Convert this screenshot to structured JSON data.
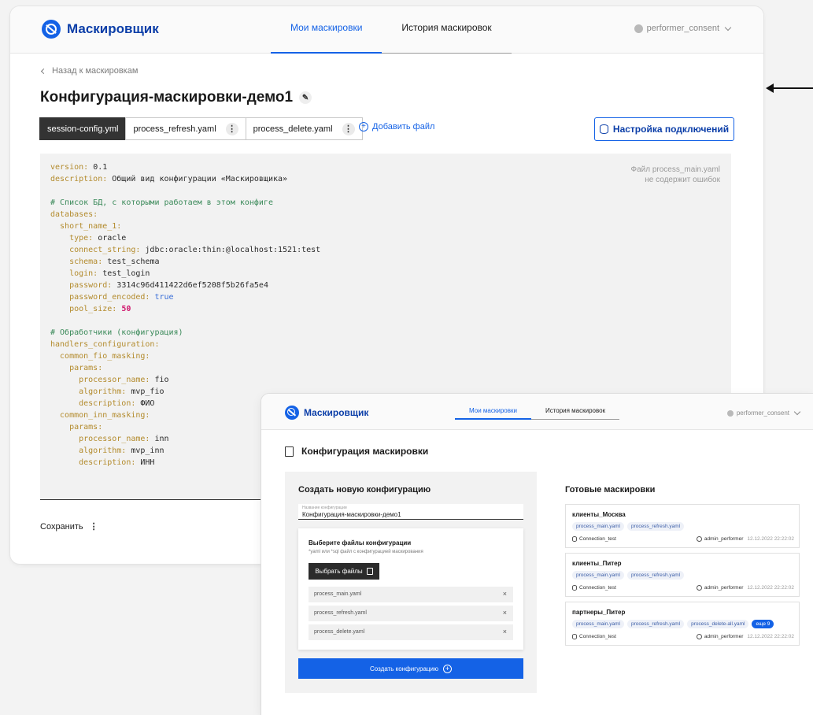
{
  "app": {
    "name": "Маскировщик",
    "nav": [
      "Мои маскировки",
      "История маскировок"
    ],
    "user": "performer_consent"
  },
  "editor": {
    "back": "Назад к маскировкам",
    "title": "Конфигурация-маскировки-демо1",
    "files": [
      "session-config.yml",
      "process_refresh.yaml",
      "process_delete.yaml"
    ],
    "add_file": "Добавить файл",
    "connections_button": "Настройка подключений",
    "validation_line1": "Файл process_main.yaml",
    "validation_line2": "не содержит ошибок",
    "save": "Сохранить",
    "code": {
      "l1k": "version:",
      "l1v": " 0.1",
      "l2k": "description:",
      "l2v": " Общий вид конфигурации «Маскировщика»",
      "l3": "# Список БД, с которыми работаем в этом конфиге",
      "l4k": "databases:",
      "l5k": "  short_name_1:",
      "l6k": "    type:",
      "l6v": " oracle",
      "l7k": "    connect_string:",
      "l7v": " jdbc:oracle:thin:@localhost:1521:test",
      "l8k": "    schema:",
      "l8v": " test_schema",
      "l9k": "    login:",
      "l9v": " test_login",
      "l10k": "    password:",
      "l10v": " 3314c96d411422d6ef5208f5b26fa5e4",
      "l11k": "    password_encoded:",
      "l11v": " true",
      "l12k": "    pool_size:",
      "l12v": " 50",
      "l13": "# Обработчики (конфигурация)",
      "l14k": "handlers_configuration:",
      "l15k": "  common_fio_masking:",
      "l16k": "    params:",
      "l17k": "      processor_name:",
      "l17v": " fio",
      "l18k": "      algorithm:",
      "l18v": " mvp_fio",
      "l19k": "      description:",
      "l19v": " ФИО",
      "l20k": "  common_inn_masking:",
      "l21k": "    params:",
      "l22k": "      processor_name:",
      "l22v": " inn",
      "l23k": "      algorithm:",
      "l23v": " mvp_inn",
      "l24k": "      description:",
      "l24v": " ИНН"
    }
  },
  "creator": {
    "page_title": "Конфигурация маскировки",
    "panel_title": "Создать новую конфигурацию",
    "name_label": "Название конфигурации",
    "name_value": "Конфигурация-маскировки-демо1",
    "files_title": "Выберите файлы конфигурации",
    "files_hint": "*yaml или *sql файл с конфигурацией маскирования",
    "pick_button": "Выбрать файлы",
    "files": [
      "process_main.yaml",
      "process_refresh.yaml",
      "process_delete.yaml"
    ],
    "create_button": "Создать конфигурацию",
    "ready_title": "Готовые маскировки",
    "ready": [
      {
        "name": "клиенты_Москва",
        "tags": [
          "process_main.yaml",
          "process_refresh.yaml"
        ],
        "more": "",
        "conn": "Connection_test",
        "user": "admin_performer",
        "date": "12.12.2022 22:22:02"
      },
      {
        "name": "клиенты_Питер",
        "tags": [
          "process_main.yaml",
          "process_refresh.yaml"
        ],
        "more": "",
        "conn": "Connection_test",
        "user": "admin_performer",
        "date": "12.12.2022 22:22:02"
      },
      {
        "name": "партнеры_Питер",
        "tags": [
          "process_main.yaml",
          "process_refresh.yaml",
          "process_delete-all.yaml"
        ],
        "more": "еще 9",
        "conn": "Connection_test",
        "user": "admin_performer",
        "date": "12.12.2022 22:22:02"
      }
    ]
  }
}
